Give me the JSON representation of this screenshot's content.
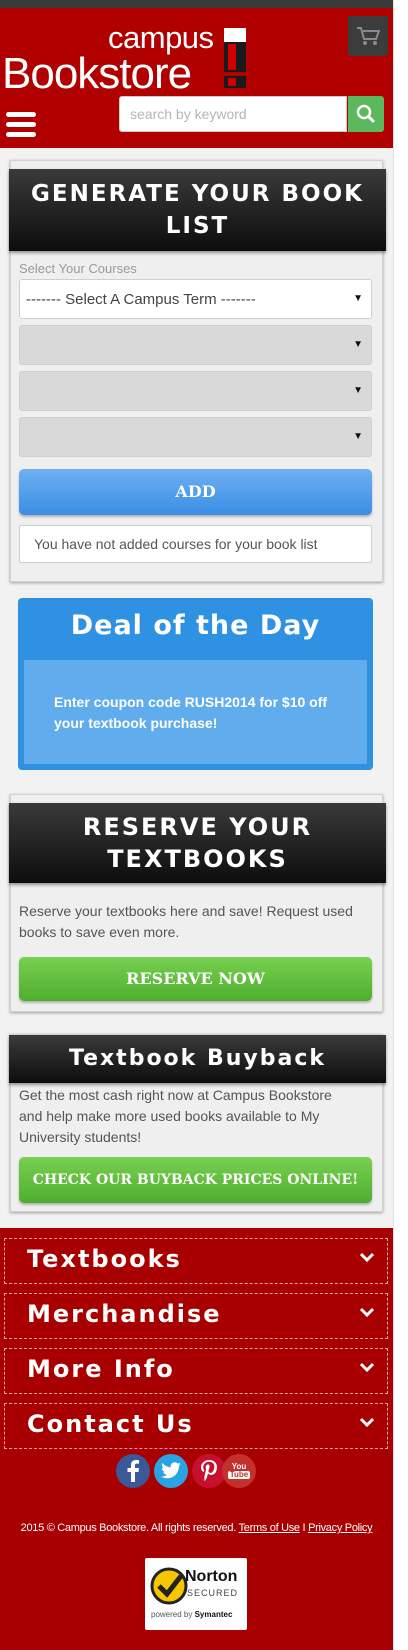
{
  "header": {
    "logo_small": "campus",
    "logo_large": "Bookstore",
    "search_placeholder": "search by keyword"
  },
  "book_list": {
    "title": "GENERATE YOUR BOOK LIST",
    "select_label": "Select Your Courses",
    "term_select_value": "------- Select A Campus Term -------",
    "add_label": "ADD",
    "empty_message": "You have not added courses for your book list"
  },
  "deal": {
    "title": "Deal of the Day",
    "text": "Enter coupon code RUSH2014 for $10 off your textbook purchase!"
  },
  "reserve": {
    "title": "RESERVE YOUR TEXTBOOKS",
    "text": "Reserve your textbooks here and save! Request used books to save even more.",
    "button": "RESERVE NOW"
  },
  "buyback": {
    "title": "Textbook Buyback",
    "text": "Get the most cash right now at Campus Bookstore and help make more used books available to My University students!",
    "button": "CHECK OUR BUYBACK PRICES ONLINE!"
  },
  "footer": {
    "menus": [
      "Textbooks",
      "Merchandise",
      "More Info",
      "Contact Us"
    ],
    "social_icons": [
      "facebook-icon",
      "twitter-icon",
      "pinterest-icon",
      "youtube-icon"
    ],
    "youtube_label_top": "You",
    "youtube_label_bottom": "Tube",
    "copyright": "2015 © Campus Bookstore. All rights reserved.",
    "terms": "Terms of Use",
    "separator": "I",
    "privacy": "Privacy Policy",
    "norton_brand": "Norton",
    "norton_secured": "SECURED",
    "norton_powered": "powered by",
    "norton_symantec": "Symantec"
  },
  "colors": {
    "brand_red": "#b00000",
    "deal_blue": "#2e91e1",
    "action_green": "#5cb85c"
  }
}
